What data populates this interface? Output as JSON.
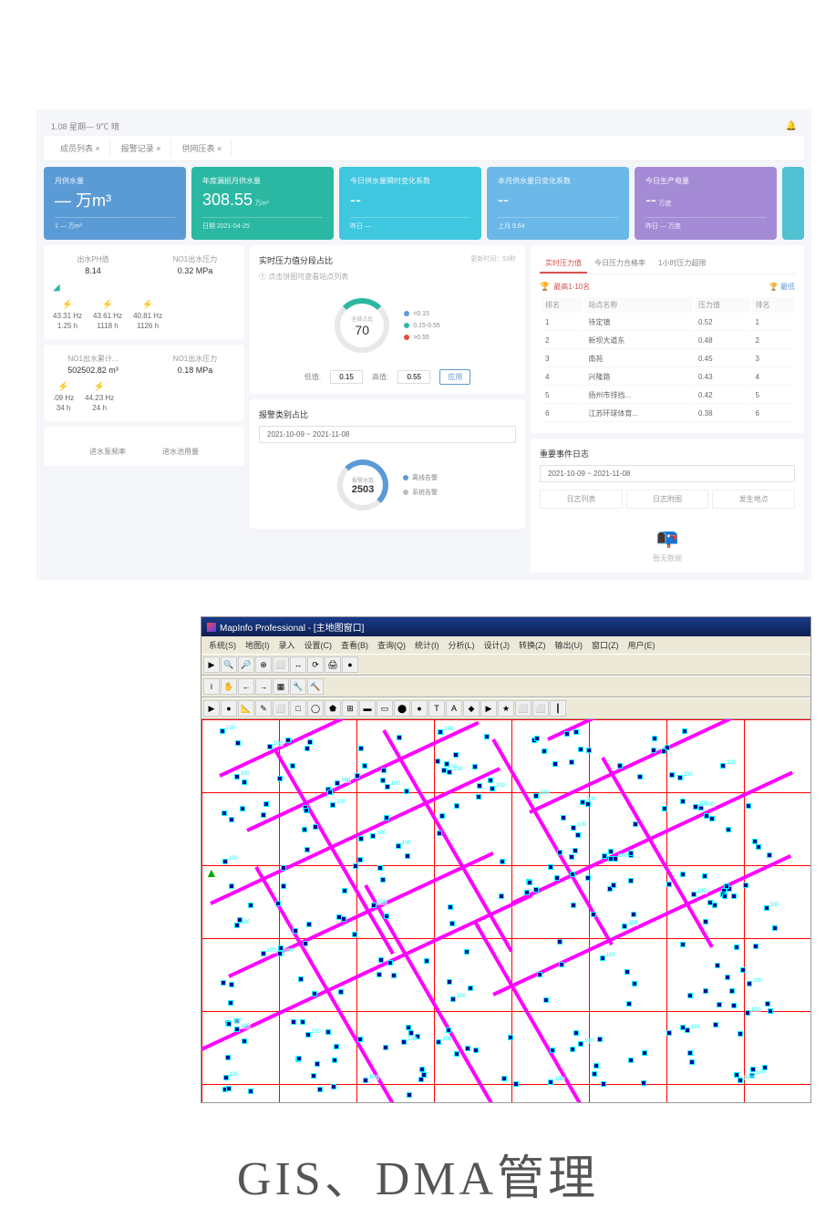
{
  "dashboard": {
    "header_time": "1.08 星期— 9℃ 晴",
    "tabs": [
      "成员列表 ×",
      "报警记录 ×",
      "供网压表 ×"
    ],
    "cards": [
      {
        "title": "月供水量",
        "value": "— 万m³",
        "footer": "1 — 万m³"
      },
      {
        "title": "年度漏损月供水量",
        "value": "308.55",
        "unit": "万m³",
        "footer": "日期 2021-04-25"
      },
      {
        "title": "今日供水量瞬时变化系数",
        "value": "--",
        "footer": "昨日 —"
      },
      {
        "title": "本月供水量日变化系数",
        "value": "--",
        "footer": "上月 9.64"
      },
      {
        "title": "今日生产电量",
        "value": "--",
        "unit": "万度",
        "footer": "昨日 — 万度"
      }
    ],
    "left_stats": [
      {
        "label": "出水PH值",
        "value": "8.14"
      },
      {
        "label": "NO1出水压力",
        "value": "0.32 MPa"
      }
    ],
    "freq": [
      {
        "hz": "43.31 Hz",
        "h": "1.25 h"
      },
      {
        "hz": "43.61 Hz",
        "h": "1118 h"
      },
      {
        "hz": "40.81 Hz",
        "h": "1126 h"
      }
    ],
    "left_stats2": [
      {
        "label": "NO1出水累计...",
        "value": "502502.82 m³"
      },
      {
        "label": "NO1出水压力",
        "value": "0.18 MPa"
      }
    ],
    "freq2": [
      {
        "hz": ".09 Hz",
        "h": "34 h"
      },
      {
        "hz": "44.23 Hz",
        "h": "24 h"
      }
    ],
    "bottom_labels": [
      "进水泵频率",
      "进水池用量"
    ],
    "pressure_panel": {
      "title": "实时压力值分段占比",
      "subtitle": "① 点击饼图可查看站点列表",
      "update": "更新时间：53秒",
      "donut_label": "全部占比",
      "donut_value": "70",
      "legend": [
        "<0.15",
        "0.15-0.55",
        ">0.55"
      ],
      "low_label": "低值:",
      "low": "0.15",
      "high_label": "高值:",
      "high": "0.55",
      "apply": "应用"
    },
    "alarm_panel": {
      "title": "报警类别占比",
      "date_range": "2021-10-09 ~ 2021-11-08",
      "donut_label": "报警总数",
      "donut_value": "2503",
      "legend": [
        "离线告警",
        "系统告警"
      ]
    },
    "right_tabs": [
      "实时压力值",
      "今日压力合格率",
      "1小时压力超限"
    ],
    "rank_title": "最高1-10名",
    "rank_title2": "最低",
    "table_headers": [
      "排名",
      "站点名称",
      "压力值",
      "排名"
    ],
    "table_rows": [
      {
        "rank": "1",
        "name": "待定镇",
        "val": "0.52",
        "r2": "1"
      },
      {
        "rank": "2",
        "name": "新坝大道东",
        "val": "0.48",
        "r2": "2"
      },
      {
        "rank": "3",
        "name": "南苑",
        "val": "0.45",
        "r2": "3"
      },
      {
        "rank": "4",
        "name": "兴隆路",
        "val": "0.43",
        "r2": "4"
      },
      {
        "rank": "5",
        "name": "扬州市排挡...",
        "val": "0.42",
        "r2": "5"
      },
      {
        "rank": "6",
        "name": "江苏环球体育...",
        "val": "0.38",
        "r2": "6"
      }
    ],
    "event_panel": {
      "title": "重要事件日志",
      "date_range": "2021-10-09 ~ 2021-11-08",
      "tabs": [
        "日志列表",
        "日志附图",
        "发生地点"
      ],
      "empty": "暂无数据"
    }
  },
  "mapinfo": {
    "title": "MapInfo Professional - [主地图窗口]",
    "menus": [
      "系统(S)",
      "地图(I)",
      "录入",
      "设置(C)",
      "查看(B)",
      "查询(Q)",
      "统计(I)",
      "分析(L)",
      "设计(J)",
      "转换(Z)",
      "输出(U)",
      "窗口(Z)",
      "用户(E)"
    ],
    "toolbar1": [
      "▶",
      "🔍",
      "🔎",
      "⊕",
      "⬜",
      "↔",
      "⟳",
      "🖨",
      "●"
    ],
    "toolbar2": [
      "i",
      "✋",
      "←",
      "→",
      "▦",
      "🔧",
      "🔨"
    ],
    "toolbar3": [
      "▶",
      "●",
      "📐",
      "✎",
      "⬜",
      "□",
      "◯",
      "⬟",
      "⊞",
      "▬",
      "▭",
      "⬤",
      "●",
      "T",
      "A",
      "◆",
      "▶",
      "★",
      "⬜",
      "⬜",
      "┃"
    ]
  },
  "footer": "GIS、DMA管理"
}
